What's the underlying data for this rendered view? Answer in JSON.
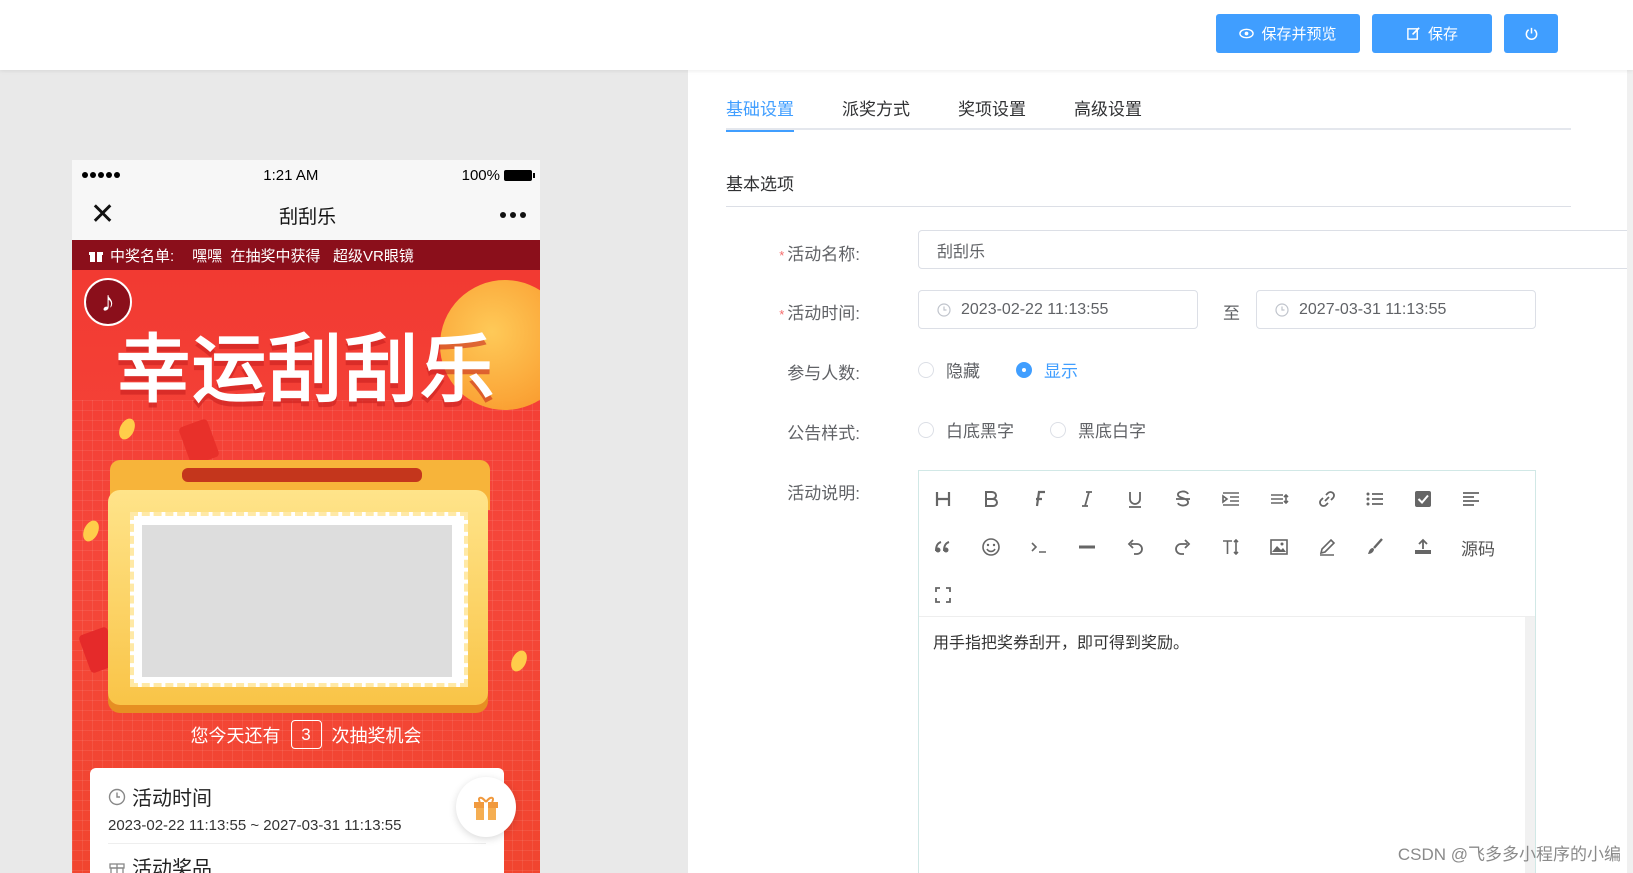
{
  "toolbar": {
    "save_preview_label": "保存并预览",
    "save_label": "保存",
    "colors": {
      "primary": "#409eff"
    }
  },
  "phone": {
    "status": {
      "time": "1:21 AM",
      "battery": "100%"
    },
    "nav_title": "刮刮乐",
    "winners_label": "中奖名单:",
    "winners_text": "嘿嘿  在抽奖中获得   超级VR眼镜",
    "headline": "幸运刮刮乐",
    "chance_prefix": "您今天还有",
    "chance_count": "3",
    "chance_suffix": "次抽奖机会",
    "info": {
      "time_title": "活动时间",
      "time_range": "2023-02-22 11:13:55 ~ 2027-03-31 11:13:55",
      "prize_title": "活动奖品"
    }
  },
  "tabs": [
    {
      "label": "基础设置",
      "active": true
    },
    {
      "label": "派奖方式",
      "active": false
    },
    {
      "label": "奖项设置",
      "active": false
    },
    {
      "label": "高级设置",
      "active": false
    }
  ],
  "section_title": "基本选项",
  "form": {
    "name_label": "活动名称:",
    "name_value": "刮刮乐",
    "time_label": "活动时间:",
    "time_start": "2023-02-22 11:13:55",
    "time_sep": "至",
    "time_end": "2027-03-31 11:13:55",
    "participants_label": "参与人数:",
    "participants_options": [
      "隐藏",
      "显示"
    ],
    "participants_selected": "显示",
    "notice_label": "公告样式:",
    "notice_options": [
      "白底黑字",
      "黑底白字"
    ],
    "notice_selected": null,
    "desc_label": "活动说明:",
    "desc_value": "用手指把奖券刮开，即可得到奖励。",
    "source_label": "源码"
  },
  "watermark": "CSDN @飞多多小程序的小编"
}
